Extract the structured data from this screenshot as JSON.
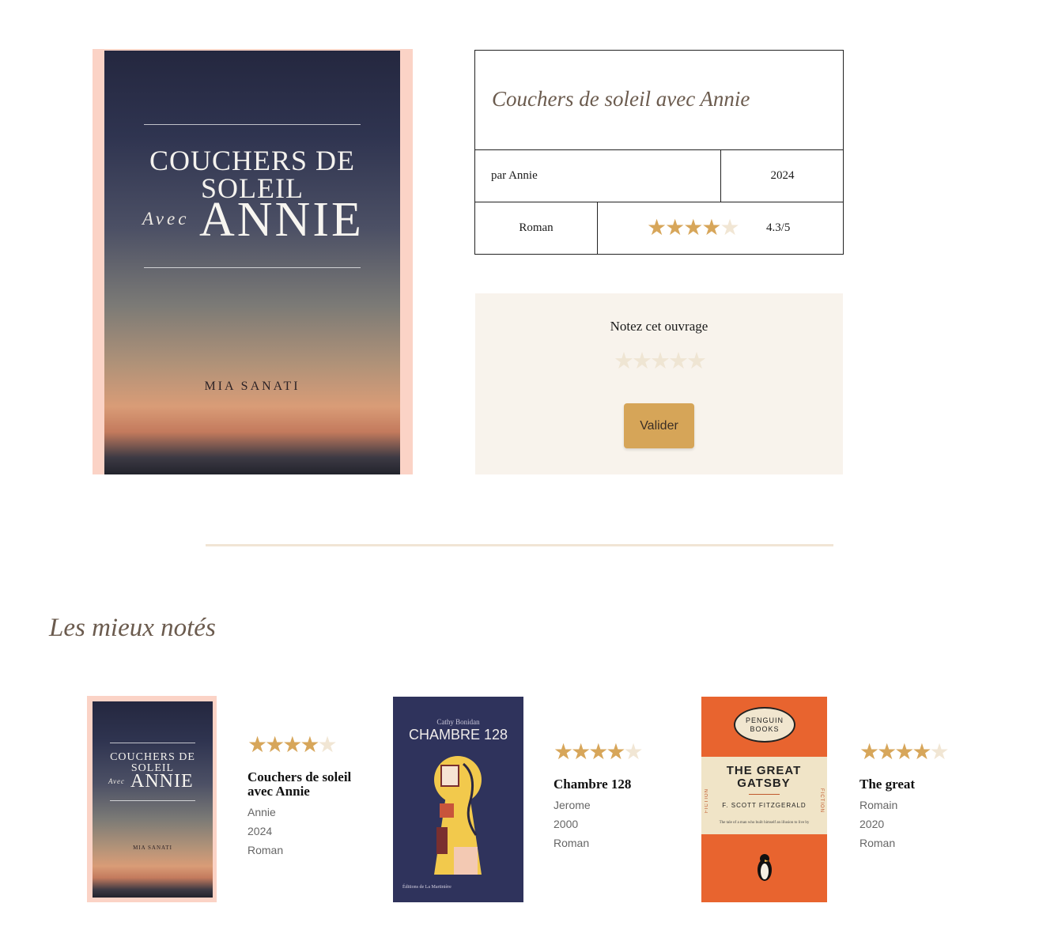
{
  "book": {
    "title": "Couchers de soleil avec Annie",
    "author_line": "par Annie",
    "year": "2024",
    "genre": "Roman",
    "rating": 4.3,
    "rating_label": "4.3/5",
    "cover": {
      "line1": "COUCHERS DE",
      "line2": "SOLEIL",
      "avec": "Avec",
      "annie": "ANNIE",
      "author": "MIA SANATI"
    }
  },
  "rate_box": {
    "label": "Notez cet ouvrage",
    "submit": "Valider",
    "selected": 0
  },
  "section": {
    "title": "Les mieux notés"
  },
  "top_rated": [
    {
      "title": "Couchers de soleil avec Annie",
      "author": "Annie",
      "year": "2024",
      "genre": "Roman",
      "rating": 4,
      "cover": {
        "line1": "COUCHERS DE",
        "line2": "SOLEIL",
        "avec": "Avec",
        "annie": "ANNIE",
        "author": "MIA SANATI"
      }
    },
    {
      "title": "Chambre 128",
      "author": "Jerome",
      "year": "2000",
      "genre": "Roman",
      "rating": 4,
      "cover": {
        "small": "Cathy Bonidan",
        "big": "CHAMBRE 128",
        "pub": "Éditions de La Martinière"
      }
    },
    {
      "title": "The great",
      "author": "Romain",
      "year": "2020",
      "genre": "Roman",
      "rating": 4,
      "cover": {
        "publisher": "PENGUIN BOOKS",
        "title": "THE GREAT GATSBY",
        "author": "F. SCOTT FITZGERALD",
        "tagline": "The tale of a man who built himself an illusion to live by",
        "side": "FICTION"
      }
    }
  ],
  "colors": {
    "star_on": "#d7a65a",
    "star_off": "#f1e6d4",
    "button": "#d6a558",
    "panel": "#f8f3ec",
    "accent_text": "#6b5b4e"
  }
}
